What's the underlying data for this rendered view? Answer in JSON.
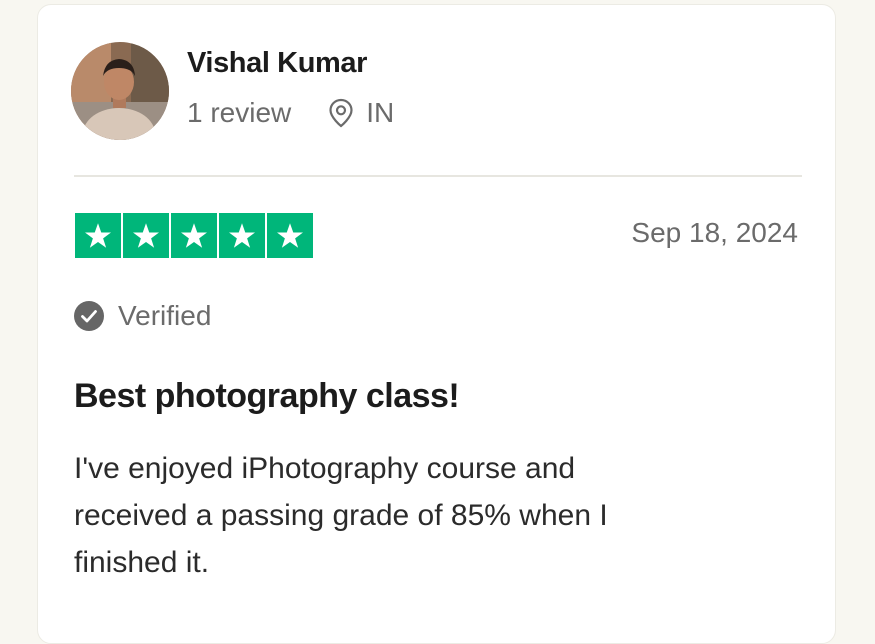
{
  "reviewer": {
    "name": "Vishal Kumar",
    "review_count": "1 review",
    "country": "IN",
    "avatar_icon": "reviewer-photo"
  },
  "review": {
    "rating": 5,
    "rating_max": 5,
    "date": "Sep 18, 2024",
    "verified_label": "Verified",
    "title": "Best photography class!",
    "body_lines": [
      "I've enjoyed iPhotography course and",
      "received a passing grade of 85% when I",
      "finished it."
    ]
  },
  "colors": {
    "star_green": "#00b67a",
    "text_dark": "#1c1c1c",
    "text_muted": "#6b6b6b",
    "page_bg": "#f8f7f1",
    "card_bg": "#ffffff"
  },
  "icons": {
    "location": "location-pin-icon",
    "verified": "check-circle-icon",
    "star": "star-icon"
  }
}
